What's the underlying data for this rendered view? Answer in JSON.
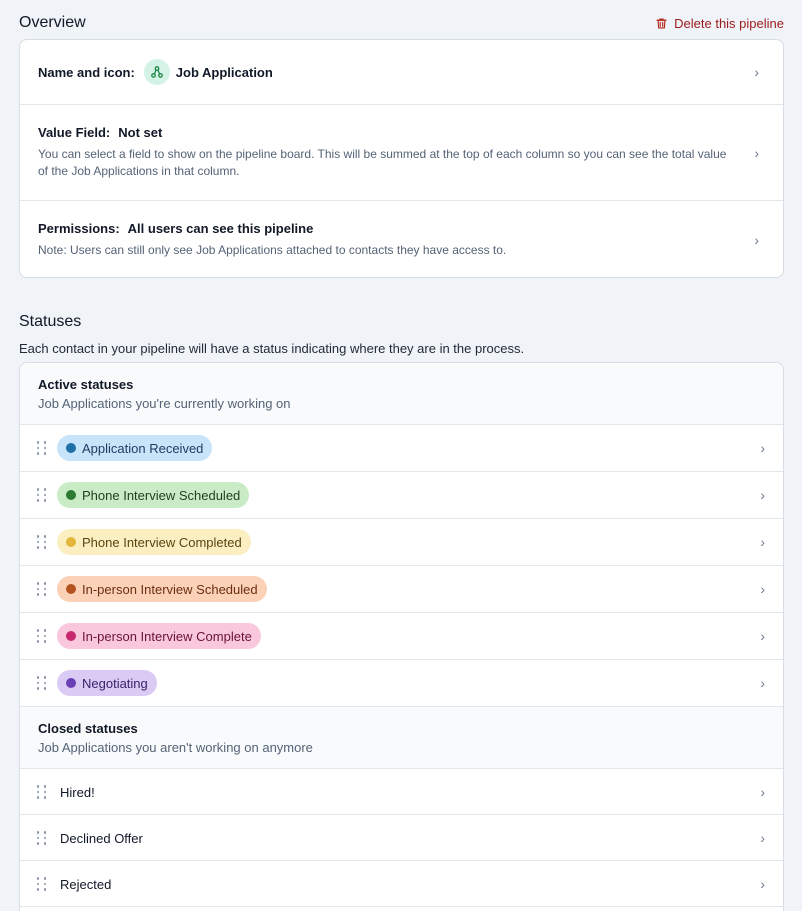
{
  "overview": {
    "title": "Overview",
    "delete_label": "Delete this pipeline",
    "name": {
      "label": "Name and icon:",
      "value": "Job Application",
      "icon": "pipeline-icon"
    },
    "value_field": {
      "label": "Value Field:",
      "value": "Not set",
      "description": "You can select a field to show on the pipeline board. This will be summed at the top of each column so you can see the total value of the Job Applications in that column."
    },
    "permissions": {
      "label": "Permissions:",
      "value": "All users can see this pipeline",
      "description": "Note: Users can still only see Job Applications attached to contacts they have access to."
    }
  },
  "statuses": {
    "title": "Statuses",
    "subtitle": "Each contact in your pipeline will have a status indicating where they are in the process.",
    "active": {
      "title": "Active statuses",
      "subtitle": "Job Applications you're currently working on",
      "items": [
        {
          "label": "Application Received",
          "bg": "#c8e4fa",
          "dot": "#1f6fa8",
          "text": "#1e3a5f"
        },
        {
          "label": "Phone Interview Scheduled",
          "bg": "#c9ecc6",
          "dot": "#2d7a32",
          "text": "#1f3d20"
        },
        {
          "label": "Phone Interview Completed",
          "bg": "#fbefc2",
          "dot": "#e2b53b",
          "text": "#5a4510"
        },
        {
          "label": "In-person Interview Scheduled",
          "bg": "#fbd2b8",
          "dot": "#b3531f",
          "text": "#6b2e10"
        },
        {
          "label": "In-person Interview Complete",
          "bg": "#f9c8dc",
          "dot": "#c8286e",
          "text": "#6b1239"
        },
        {
          "label": "Negotiating",
          "bg": "#dacbf4",
          "dot": "#6b3fb5",
          "text": "#3a1f6b"
        }
      ]
    },
    "closed": {
      "title": "Closed statuses",
      "subtitle": "Job Applications you aren't working on anymore",
      "items": [
        {
          "label": "Hired!"
        },
        {
          "label": "Declined Offer"
        },
        {
          "label": "Rejected"
        }
      ]
    }
  }
}
